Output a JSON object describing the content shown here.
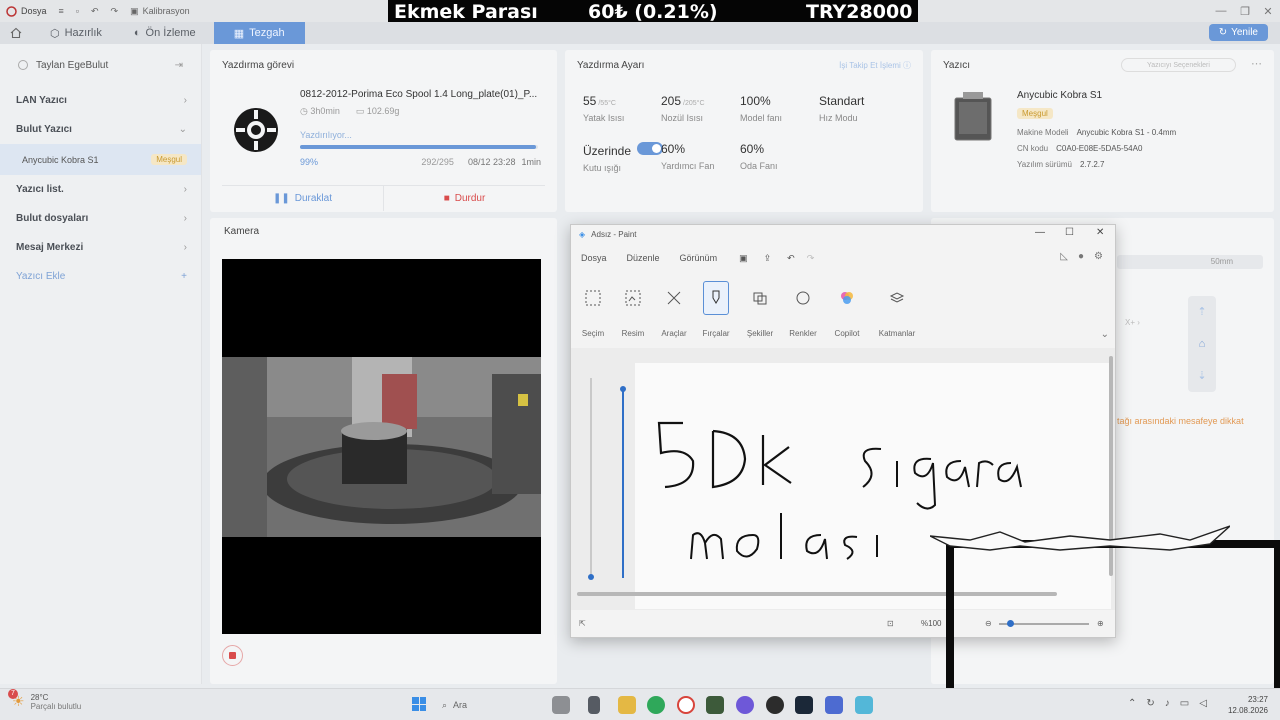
{
  "titlebar": {
    "menu_file": "Dosya",
    "calibration": "Kalibrasyon"
  },
  "overlay_banner": {
    "title": "Ekmek Parası",
    "amount": "60₺ (0.21%)",
    "total": "TRY28000"
  },
  "nav": {
    "tabs": [
      {
        "label": "Hazırlık",
        "icon": "cube-icon"
      },
      {
        "label": "Ön İzleme",
        "icon": "preview-icon"
      },
      {
        "label": "Tezgah",
        "icon": "grid-icon",
        "active": true
      }
    ],
    "refresh_label": "Yenile"
  },
  "sidebar": {
    "user_name": "Taylan EgeBulut",
    "items": [
      {
        "label": "LAN Yazıcı",
        "chevron": "›"
      },
      {
        "label": "Bulut Yazıcı",
        "chevron": "⌄"
      },
      {
        "label": "Yazıcı list.",
        "chevron": "›"
      },
      {
        "label": "Bulut dosyaları",
        "chevron": "›"
      },
      {
        "label": "Mesaj Merkezi",
        "chevron": "›"
      }
    ],
    "printer_entry": {
      "name": "Anycubic Kobra S1",
      "status": "Meşgul"
    },
    "add_printer": "Yazıcı Ekle",
    "add_symbol": "+"
  },
  "job": {
    "title": "Yazdırma görevi",
    "file_name": "0812-2012-Porima Eco Spool 1.4 Long_plate(01)_P...",
    "duration": "3h0min",
    "weight": "102.69g",
    "status": "Yazdırılıyor...",
    "progress": 0.99,
    "percent": "99%",
    "layers": "292/295",
    "eta": "08/12 23:28",
    "remaining": "1min",
    "pause_label": "Duraklat",
    "stop_label": "Durdur"
  },
  "settings": {
    "title": "Yazdırma Ayarı",
    "help_link": "İşi Takip Et İşlemi",
    "cells": [
      {
        "value": "55",
        "target": "/55°C",
        "label": "Yatak Isısı"
      },
      {
        "value": "205",
        "target": "/205°C",
        "label": "Nozül Isısı"
      },
      {
        "value": "100%",
        "target": "",
        "label": "Model fanı"
      },
      {
        "value": "Standart",
        "target": "",
        "label": "Hız Modu"
      },
      {
        "value": "Üzerinde",
        "target": "",
        "label": "Kutu ışığı"
      },
      {
        "value": "60%",
        "target": "",
        "label": "Yardımcı Fan"
      },
      {
        "value": "60%",
        "target": "",
        "label": "Oda Fanı"
      }
    ]
  },
  "printer": {
    "title": "Yazıcı",
    "selector": "Yazıcıyı Seçenekleri",
    "name": "Anycubic Kobra S1",
    "status": "Meşgul",
    "model_label": "Makine Modeli",
    "model_value": "Anycubic Kobra S1 - 0.4mm",
    "cn_label": "CN kodu",
    "cn_value": "C0A0-E08E-5DA5-54A0",
    "fw_label": "Yazılım sürümü",
    "fw_value": "2.7.2.7"
  },
  "camera": {
    "title": "Kamera"
  },
  "right_panel": {
    "step_label": "50mm",
    "axis_label": "X+",
    "warning": "tağı arasındaki mesafeye dikkat"
  },
  "paint": {
    "title": "Adsız - Paint",
    "menu": [
      "Dosya",
      "Düzenle",
      "Görünüm"
    ],
    "tools": [
      {
        "label": "Seçim",
        "icon": "selection-icon"
      },
      {
        "label": "Resim",
        "icon": "image-icon"
      },
      {
        "label": "Araçlar",
        "icon": "tools-icon"
      },
      {
        "label": "Fırçalar",
        "icon": "brush-icon"
      },
      {
        "label": "Şekiller",
        "icon": "shapes-icon"
      },
      {
        "label": "Renkler",
        "icon": "palette-icon"
      },
      {
        "label": "Copilot",
        "icon": "copilot-icon"
      },
      {
        "label": "Katmanlar",
        "icon": "layers-icon"
      }
    ],
    "handwriting_line1": "5Dk sigara",
    "handwriting_line2": "molası",
    "zoom": "%100",
    "zoom_level": 1.0
  },
  "taskbar": {
    "temperature": "28°C",
    "weather_desc": "Parçalı bulutlu",
    "search_placeholder": "Ara",
    "time": "23:27",
    "date": "12.08.2026",
    "notification_count": "7"
  },
  "colors": {
    "accent": "#6a98d8",
    "busy_badge": "#c99a30",
    "danger": "#d94c4c"
  }
}
